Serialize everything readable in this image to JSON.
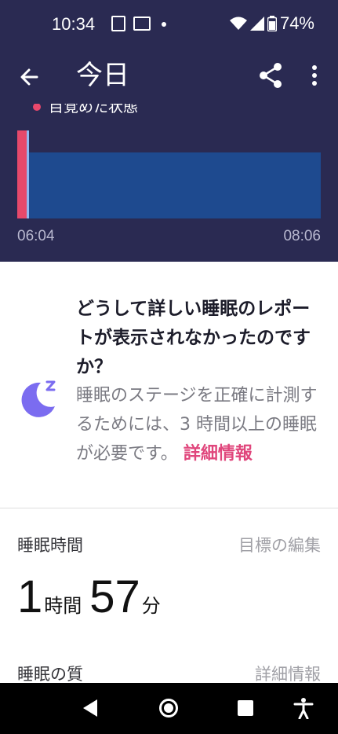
{
  "status": {
    "time": "10:34",
    "battery": "74%"
  },
  "header": {
    "title": "今日"
  },
  "chart": {
    "legend_label": "目覚めた状態",
    "start_time": "06:04",
    "end_time": "08:06"
  },
  "info": {
    "title": "どうして詳しい睡眠のレポートが表示されなかったのですか？",
    "body": "睡眠のステージを正確に計測するためには、3 時間以上の睡眠が必要です。",
    "learn_more": "詳細情報"
  },
  "sleep_time": {
    "label": "睡眠時間",
    "edit_goal": "目標の編集",
    "hours": "1",
    "hours_unit": "時間",
    "minutes": "57",
    "minutes_unit": "分"
  },
  "sleep_quality": {
    "label": "睡眠の質",
    "details": "詳細情報"
  },
  "colors": {
    "header_bg": "#2a2a52",
    "awake": "#e6496b",
    "sleep_bar": "#1e4a8f",
    "accent_link": "#e0467c",
    "moon": "#7b6cf0"
  }
}
